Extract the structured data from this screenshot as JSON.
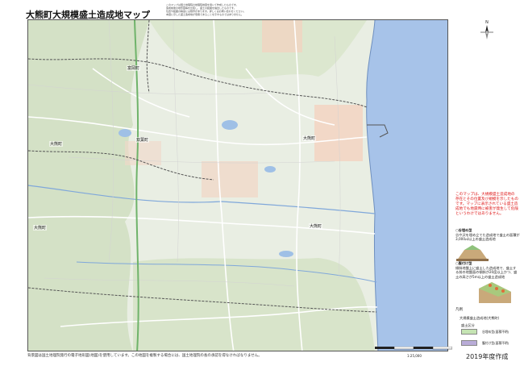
{
  "title": "大熊町大規模盛土造成地マップ",
  "header_notes": [
    "このマップは国土地理院の地理院地図を用いて作成したものです。",
    "造成前後の地形図等を比較し、盛土の範囲を抽出したものです。",
    "位置や範囲の精度には限界があります。詳しくはお問い合わせください。",
    "本図に示した盛土造成地が危険であることを示すものではありません。"
  ],
  "places": {
    "p1": "富岡町",
    "p2": "双葉町",
    "p3": "大熊町",
    "p4": "大熊町",
    "p5": "大熊町",
    "p6": "大熊町"
  },
  "info_text": "このマップは、大規模盛土造成地の存在とその位置及び規模を示したものです。マップに表示されている盛土造成地でも地震時に被害が発生して危険というわけではありません。",
  "legend": {
    "type1_head": "○谷埋め型",
    "type1_text": "谷や沢を埋め立てた造成地で盛土の面積が3,000㎡以上の盛土造成地",
    "type2_head": "○腹付け型",
    "type2_text": "傾斜地盤上に盛土した造成地で、盛土する前の地盤面の傾斜が20度以上かつ、盛土の高さが5m以上の盛土造成地",
    "box_title": "凡例",
    "name": "大規模盛土造成地(大熊町)",
    "division_title": "盛土区分",
    "items": [
      {
        "label": "谷埋め型(面積不明)",
        "color": "#c5e4b3"
      },
      {
        "label": "腹付け型(面積不明)",
        "color": "#b9acd8"
      }
    ]
  },
  "footer_note": "背景図は国土地理院発行の電子地形図(地図)を使用しています。この地図を複製する場合には、国土地理院の長の承認を得なければなりません。",
  "scale": "1:25,000",
  "year": "2019年度作成",
  "colors": {
    "sea": "#a7c3e9",
    "land": "#e9eee3",
    "forest": "#d4e1c6",
    "road": "#ffffff",
    "highway": "#6fb36a",
    "boundary": "#555555",
    "urban": "#f0c1a8",
    "legend_red": "#dd1111"
  }
}
